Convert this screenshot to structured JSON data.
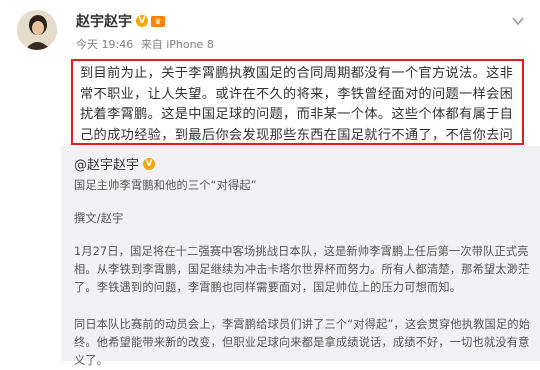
{
  "post": {
    "author": "赵宇赵宇",
    "verified_badge": "V",
    "time": "今天 19:46",
    "source": "来自 iPhone 8",
    "text": "到目前为止，关于李霄鹏执教国足的合同周期都没有一个官方说法。这非常不职业，让人失望。或许在不久的将来，李铁曾经面对的问题一样会困扰着李霄鹏。这是中国足球的问题，而非某一个体。这些个体都有属于自己的成功经验，到最后你会发现那些东西在国足就行不通了，不信你去问问“不懂球”的里皮。",
    "icons": {
      "avatar": "avatar-photo",
      "member": "member-icon",
      "menu": "chevron-down-icon"
    }
  },
  "quoted": {
    "author": "@赵宇赵宇",
    "badge": "V",
    "title": "国足主帅李霄鹏和他的三个“对得起”",
    "byline": "撰文/赵宇",
    "para1": "1月27日，国足将在十二强赛中客场挑战日本队，这是新帅李霄鹏上任后第一次带队正式亮相。从李铁到李霄鹏，国足继续为冲击卡塔尔世界杯而努力。所有人都清楚，那希望太渺茫了。李铁遇到的问题，李霄鹏也同样需要面对，国足帅位上的压力可想而知。",
    "para2": "同日本队比赛前的动员会上，李霄鹏给球员们讲了三个“对得起”，这会贯穿他执教国足的始终。他希望能带来新的改变，但职业足球向来都是拿成绩说话，成绩不好，一切也就没有意义了。"
  }
}
